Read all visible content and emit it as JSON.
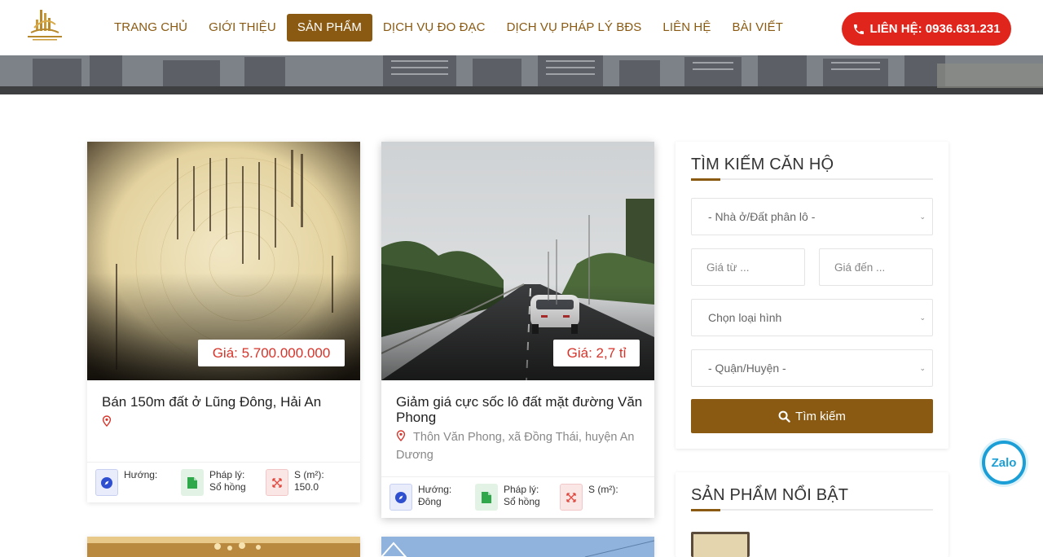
{
  "header": {
    "nav": [
      {
        "label": "TRANG CHỦ"
      },
      {
        "label": "GIỚI THIỆU"
      },
      {
        "label": "SẢN PHẨM"
      },
      {
        "label": "DỊCH VỤ ĐO ĐẠC"
      },
      {
        "label": "DỊCH VỤ PHÁP LÝ BĐS"
      },
      {
        "label": "LIÊN HỆ"
      },
      {
        "label": "BÀI VIẾT"
      }
    ],
    "active_nav": "SẢN PHẨM",
    "hotline": "LIÊN HỆ: 0936.631.231"
  },
  "products": [
    {
      "title": "Bán 150m đất ở Lũng Đông, Hải An",
      "address": "",
      "price": "Giá: 5.700.000.000",
      "direction_label": "Hướng:",
      "direction_value": "",
      "legal_label": "Pháp lý:",
      "legal_value": "Sổ hồng",
      "area_label": "S (m²):",
      "area_value": "150.0"
    },
    {
      "title": "Giảm giá cực sốc lô đất mặt đường Văn Phong",
      "address": "Thôn Văn Phong, xã Đồng Thái, huyện An Dương",
      "price": "Giá: 2,7 tỉ",
      "direction_label": "Hướng:",
      "direction_value": "Đông",
      "legal_label": "Pháp lý:",
      "legal_value": "Sổ hồng",
      "area_label": "S (m²):",
      "area_value": ""
    }
  ],
  "search": {
    "title": "TÌM KIẾM CĂN HỘ",
    "property_type": "- Nhà ở/Đất phân lô -",
    "price_from_placeholder": "Giá từ ...",
    "price_to_placeholder": "Giá đến ...",
    "category": "Chọn loại hình",
    "district": "- Quận/Huyện -",
    "button": "Tìm kiếm"
  },
  "featured": {
    "title": "SẢN PHẨM NỔI BẬT"
  },
  "zalo": "Zalo",
  "colors": {
    "brand": "#8a5a12",
    "hotline": "#e0261c",
    "price": "#d6342a",
    "zalo": "#1b9fd6"
  }
}
